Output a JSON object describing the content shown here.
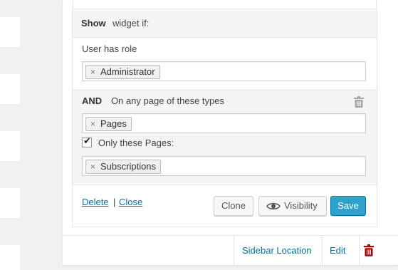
{
  "header": {
    "show_label": "Show",
    "widget_if_label": "widget if:"
  },
  "rule1": {
    "condition_label": "User has role",
    "tokens": [
      "Administrator"
    ]
  },
  "rule2": {
    "operator": "AND",
    "condition_label": "On any page of these types",
    "tokens": [
      "Pages"
    ],
    "only_these_label": "Only these Pages:",
    "only_these_checked": true,
    "sub_tokens": [
      "Subscriptions"
    ]
  },
  "footer": {
    "delete_label": "Delete",
    "separator": "|",
    "close_label": "Close",
    "clone_label": "Clone",
    "visibility_label": "Visibility",
    "save_label": "Save"
  },
  "bottom_bar": {
    "sidebar_location_label": "Sidebar Location",
    "edit_label": "Edit"
  },
  "token_remove_glyph": "×",
  "colors": {
    "link": "#0073aa",
    "primary_button": "#2ea2cc",
    "trash_red": "#a00",
    "trash_grey": "#a0a5aa"
  },
  "icons": [
    "remove-token-icon",
    "trash-icon",
    "eye-icon",
    "checkmark-icon"
  ]
}
